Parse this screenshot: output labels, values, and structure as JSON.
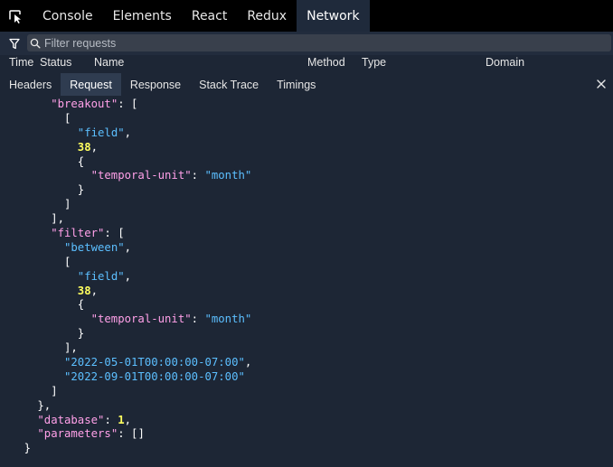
{
  "top_tabs": [
    "Console",
    "Elements",
    "React",
    "Redux",
    "Network"
  ],
  "active_top_tab": "Network",
  "filter": {
    "placeholder": "Filter requests",
    "value": ""
  },
  "columns": [
    "Time",
    "Status",
    "Name",
    "Method",
    "Type",
    "Domain"
  ],
  "sub_tabs": [
    "Headers",
    "Request",
    "Response",
    "Stack Trace",
    "Timings"
  ],
  "active_sub_tab": "Request",
  "close_label": "×",
  "code_lines": [
    {
      "indent": 4,
      "tokens": [
        {
          "t": "k",
          "v": "\"breakout\""
        },
        {
          "t": "p",
          "v": ": ["
        }
      ]
    },
    {
      "indent": 5,
      "tokens": [
        {
          "t": "p",
          "v": "["
        }
      ]
    },
    {
      "indent": 6,
      "tokens": [
        {
          "t": "s",
          "v": "\"field\""
        },
        {
          "t": "p",
          "v": ","
        }
      ]
    },
    {
      "indent": 6,
      "tokens": [
        {
          "t": "n",
          "v": "38"
        },
        {
          "t": "p",
          "v": ","
        }
      ]
    },
    {
      "indent": 6,
      "tokens": [
        {
          "t": "p",
          "v": "{"
        }
      ]
    },
    {
      "indent": 7,
      "tokens": [
        {
          "t": "k",
          "v": "\"temporal-unit\""
        },
        {
          "t": "p",
          "v": ": "
        },
        {
          "t": "s",
          "v": "\"month\""
        }
      ]
    },
    {
      "indent": 6,
      "tokens": [
        {
          "t": "p",
          "v": "}"
        }
      ]
    },
    {
      "indent": 5,
      "tokens": [
        {
          "t": "p",
          "v": "]"
        }
      ]
    },
    {
      "indent": 4,
      "tokens": [
        {
          "t": "p",
          "v": "],"
        }
      ]
    },
    {
      "indent": 4,
      "tokens": [
        {
          "t": "k",
          "v": "\"filter\""
        },
        {
          "t": "p",
          "v": ": ["
        }
      ]
    },
    {
      "indent": 5,
      "tokens": [
        {
          "t": "s",
          "v": "\"between\""
        },
        {
          "t": "p",
          "v": ","
        }
      ]
    },
    {
      "indent": 5,
      "tokens": [
        {
          "t": "p",
          "v": "["
        }
      ]
    },
    {
      "indent": 6,
      "tokens": [
        {
          "t": "s",
          "v": "\"field\""
        },
        {
          "t": "p",
          "v": ","
        }
      ]
    },
    {
      "indent": 6,
      "tokens": [
        {
          "t": "n",
          "v": "38"
        },
        {
          "t": "p",
          "v": ","
        }
      ]
    },
    {
      "indent": 6,
      "tokens": [
        {
          "t": "p",
          "v": "{"
        }
      ]
    },
    {
      "indent": 7,
      "tokens": [
        {
          "t": "k",
          "v": "\"temporal-unit\""
        },
        {
          "t": "p",
          "v": ": "
        },
        {
          "t": "s",
          "v": "\"month\""
        }
      ]
    },
    {
      "indent": 6,
      "tokens": [
        {
          "t": "p",
          "v": "}"
        }
      ]
    },
    {
      "indent": 5,
      "tokens": [
        {
          "t": "p",
          "v": "],"
        }
      ]
    },
    {
      "indent": 5,
      "tokens": [
        {
          "t": "s",
          "v": "\"2022-05-01T00:00:00-07:00\""
        },
        {
          "t": "p",
          "v": ","
        }
      ]
    },
    {
      "indent": 5,
      "tokens": [
        {
          "t": "s",
          "v": "\"2022-09-01T00:00:00-07:00\""
        }
      ]
    },
    {
      "indent": 4,
      "tokens": [
        {
          "t": "p",
          "v": "]"
        }
      ]
    },
    {
      "indent": 3,
      "tokens": [
        {
          "t": "p",
          "v": "},"
        }
      ]
    },
    {
      "indent": 3,
      "tokens": [
        {
          "t": "k",
          "v": "\"database\""
        },
        {
          "t": "p",
          "v": ": "
        },
        {
          "t": "n",
          "v": "1"
        },
        {
          "t": "p",
          "v": ","
        }
      ]
    },
    {
      "indent": 3,
      "tokens": [
        {
          "t": "k",
          "v": "\"parameters\""
        },
        {
          "t": "p",
          "v": ": []"
        }
      ]
    },
    {
      "indent": 2,
      "tokens": [
        {
          "t": "p",
          "v": "}"
        }
      ]
    }
  ],
  "colors": {
    "background": "#1d2635",
    "topbar": "#000000",
    "key": "#ffa0e8",
    "string": "#5cbfff",
    "number": "#ffff5f"
  }
}
